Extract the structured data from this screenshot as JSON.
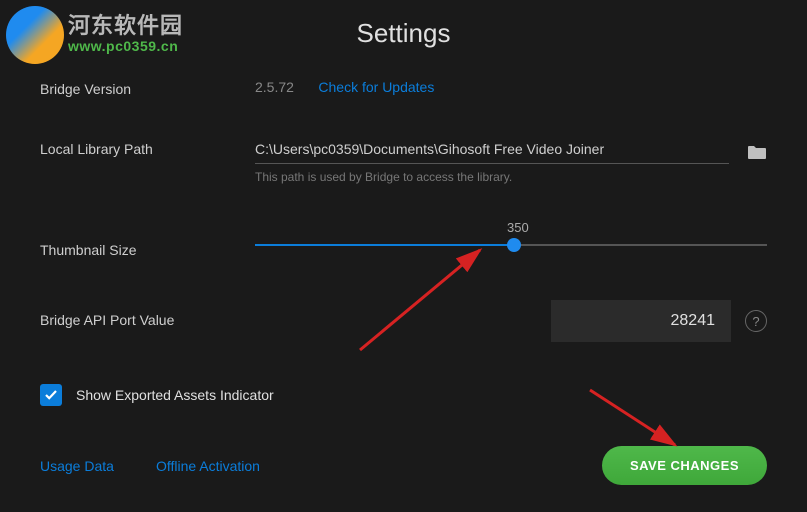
{
  "title": "Settings",
  "watermark": {
    "text_cn": "河东软件园",
    "url": "www.pc0359.cn"
  },
  "bridge_version": {
    "label": "Bridge Version",
    "value": "2.5.72",
    "check_link": "Check for Updates"
  },
  "library_path": {
    "label": "Local Library Path",
    "value": "C:\\Users\\pc0359\\Documents\\Gihosoft Free Video Joiner",
    "hint": "This path is used by Bridge to access the library."
  },
  "thumbnail": {
    "label": "Thumbnail Size",
    "value": "350"
  },
  "port": {
    "label": "Bridge API Port Value",
    "value": "28241"
  },
  "exported_assets": {
    "label": "Show Exported Assets Indicator",
    "checked": true
  },
  "footer": {
    "usage_data": "Usage Data",
    "offline_activation": "Offline Activation",
    "save": "SAVE CHANGES"
  }
}
